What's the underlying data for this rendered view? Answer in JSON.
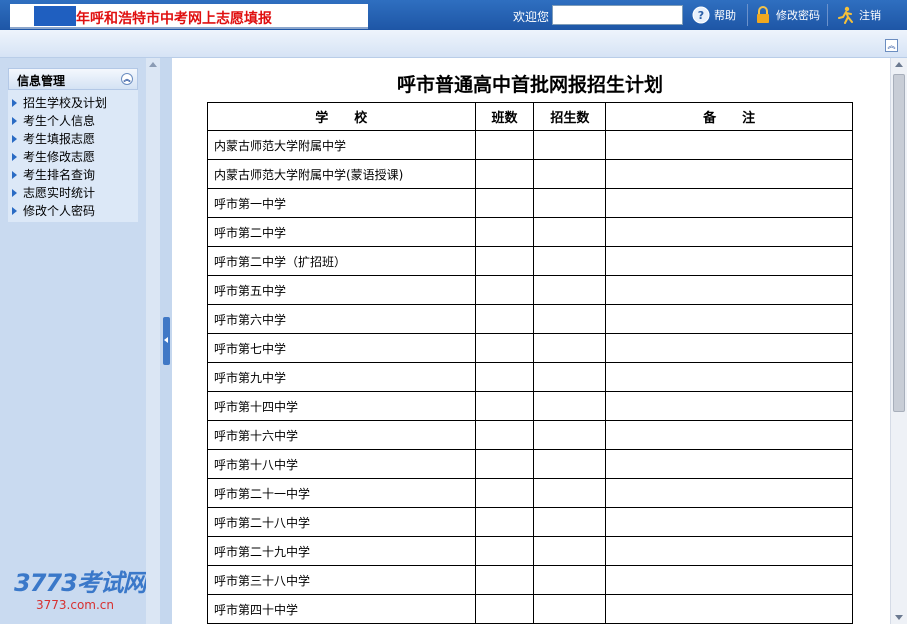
{
  "header": {
    "title": "年呼和浩特市中考网上志愿填报",
    "welcome_label": "欢迎您",
    "welcome_value": "",
    "help_label": "帮助",
    "change_password_label": "修改密码",
    "logout_label": "注销"
  },
  "sidebar": {
    "panel_title": "信息管理",
    "items": [
      {
        "label": "招生学校及计划"
      },
      {
        "label": "考生个人信息"
      },
      {
        "label": "考生填报志愿"
      },
      {
        "label": "考生修改志愿"
      },
      {
        "label": "考生排名查询"
      },
      {
        "label": "志愿实时统计"
      },
      {
        "label": "修改个人密码"
      }
    ],
    "watermark_main": "3773考试网",
    "watermark_url": "3773.com.cn"
  },
  "main": {
    "page_title": "呼市普通高中首批网报招生计划",
    "columns": [
      "学　　校",
      "班数",
      "招生数",
      "备　　注"
    ],
    "rows": [
      [
        "内蒙古师范大学附属中学",
        "",
        "",
        ""
      ],
      [
        "内蒙古师范大学附属中学(蒙语授课)",
        "",
        "",
        ""
      ],
      [
        "呼市第一中学",
        "",
        "",
        ""
      ],
      [
        "呼市第二中学",
        "",
        "",
        ""
      ],
      [
        "呼市第二中学（扩招班）",
        "",
        "",
        ""
      ],
      [
        "呼市第五中学",
        "",
        "",
        ""
      ],
      [
        "呼市第六中学",
        "",
        "",
        ""
      ],
      [
        "呼市第七中学",
        "",
        "",
        ""
      ],
      [
        "呼市第九中学",
        "",
        "",
        ""
      ],
      [
        "呼市第十四中学",
        "",
        "",
        ""
      ],
      [
        "呼市第十六中学",
        "",
        "",
        ""
      ],
      [
        "呼市第十八中学",
        "",
        "",
        ""
      ],
      [
        "呼市第二十一中学",
        "",
        "",
        ""
      ],
      [
        "呼市第二十八中学",
        "",
        "",
        ""
      ],
      [
        "呼市第二十九中学",
        "",
        "",
        ""
      ],
      [
        "呼市第三十八中学",
        "",
        "",
        ""
      ],
      [
        "呼市第四十中学",
        "",
        "",
        ""
      ]
    ]
  },
  "colors": {
    "header_blue": "#1f5fc0",
    "title_red": "#e01010",
    "sidebar_bg": "#c9daf0"
  }
}
